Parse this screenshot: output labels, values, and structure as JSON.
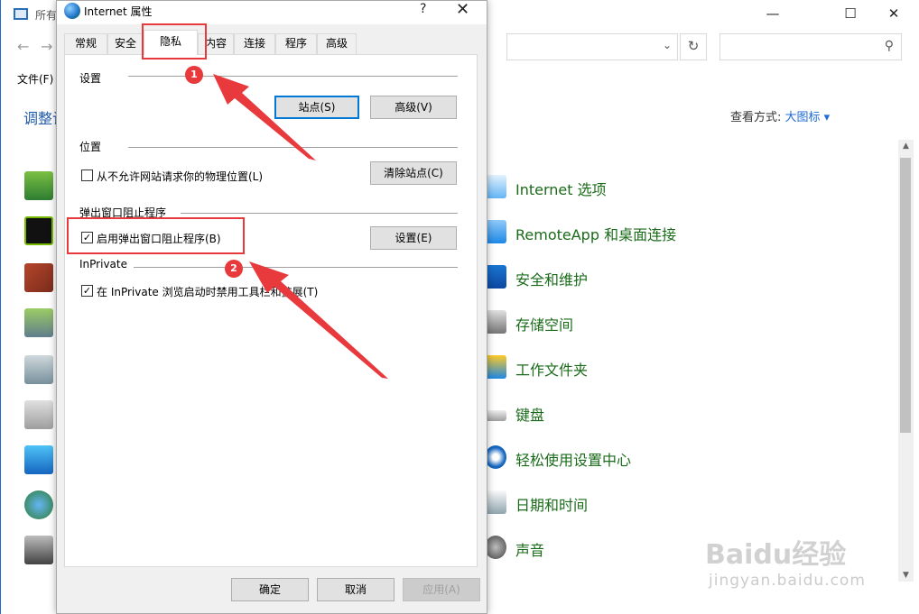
{
  "control_panel": {
    "title": "所有",
    "menu_file": "文件(F)",
    "adjust_label": "调整计",
    "view_label": "查看方式:",
    "view_value": "大图标 ▾",
    "items": [
      {
        "label": "Internet 选项"
      },
      {
        "label": "RemoteApp 和桌面连接"
      },
      {
        "label": "安全和维护"
      },
      {
        "label": "存储空间"
      },
      {
        "label": "工作文件夹"
      },
      {
        "label": "键盘"
      },
      {
        "label": "轻松使用设置中心"
      },
      {
        "label": "日期和时间"
      },
      {
        "label": "声音"
      }
    ]
  },
  "dialog": {
    "title": "Internet 属性",
    "help": "?",
    "close": "✕",
    "tabs": [
      "常规",
      "安全",
      "隐私",
      "内容",
      "连接",
      "程序",
      "高级"
    ],
    "active_tab": "隐私",
    "settings": {
      "heading": "设置",
      "sites_button": "站点(S)",
      "advanced_button": "高级(V)"
    },
    "location": {
      "heading": "位置",
      "checkbox_label": "从不允许网站请求你的物理位置(L)",
      "checked": false,
      "clear_button": "清除站点(C)"
    },
    "popup": {
      "heading": "弹出窗口阻止程序",
      "checkbox_label": "启用弹出窗口阻止程序(B)",
      "checked": true,
      "settings_button": "设置(E)"
    },
    "inprivate": {
      "heading": "InPrivate",
      "checkbox_label": "在 InPrivate 浏览启动时禁用工具栏和扩展(T)",
      "checked": true
    },
    "footer": {
      "ok": "确定",
      "cancel": "取消",
      "apply": "应用(A)"
    }
  },
  "annotations": [
    "1",
    "2"
  ],
  "watermark": {
    "main": "Baidu经验",
    "sub": "jingyan.baidu.com"
  },
  "colors": {
    "accent": "#0078d7",
    "annotation": "#e8393c",
    "link_green": "#1a6b1a"
  }
}
